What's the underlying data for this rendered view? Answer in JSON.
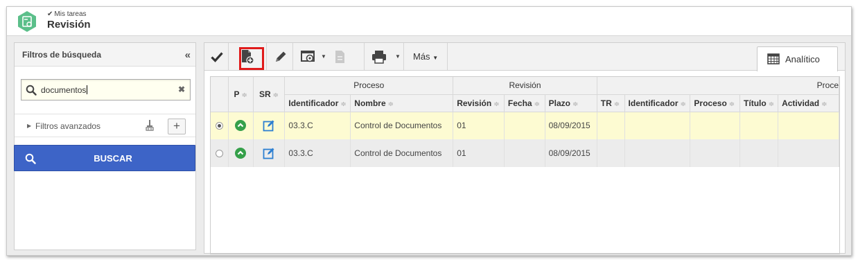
{
  "header": {
    "breadcrumb": "Mis tareas",
    "title": "Revisión"
  },
  "filters": {
    "title": "Filtros de búsqueda",
    "search_value": "documentos",
    "advanced_label": "Filtros avanzados",
    "search_button": "BUSCAR"
  },
  "toolbar": {
    "more_label": "Más",
    "view_tab": "Analítico"
  },
  "grid": {
    "groups": {
      "proceso": "Proceso",
      "revision": "Revisión",
      "proceso2": "Proce"
    },
    "columns": {
      "p": "P",
      "sr": "SR",
      "identificador": "Identificador",
      "nombre": "Nombre",
      "revision": "Revisión",
      "fecha": "Fecha",
      "plazo": "Plazo",
      "tr": "TR",
      "identificador2": "Identificador",
      "proceso": "Proceso",
      "titulo": "Título",
      "actividad": "Actividad"
    },
    "rows": [
      {
        "identificador": "03.3.C",
        "nombre": "Control de Documentos",
        "revision": "01",
        "fecha": "",
        "plazo": "08/09/2015",
        "selected": true
      },
      {
        "identificador": "03.3.C",
        "nombre": "Control de Documentos",
        "revision": "01",
        "fecha": "",
        "plazo": "08/09/2015",
        "selected": false
      }
    ]
  },
  "colors": {
    "accent_blue": "#3d64c7",
    "highlight_red": "#e01b1b",
    "status_green": "#35a04a",
    "app_green": "#5bbf8a"
  }
}
